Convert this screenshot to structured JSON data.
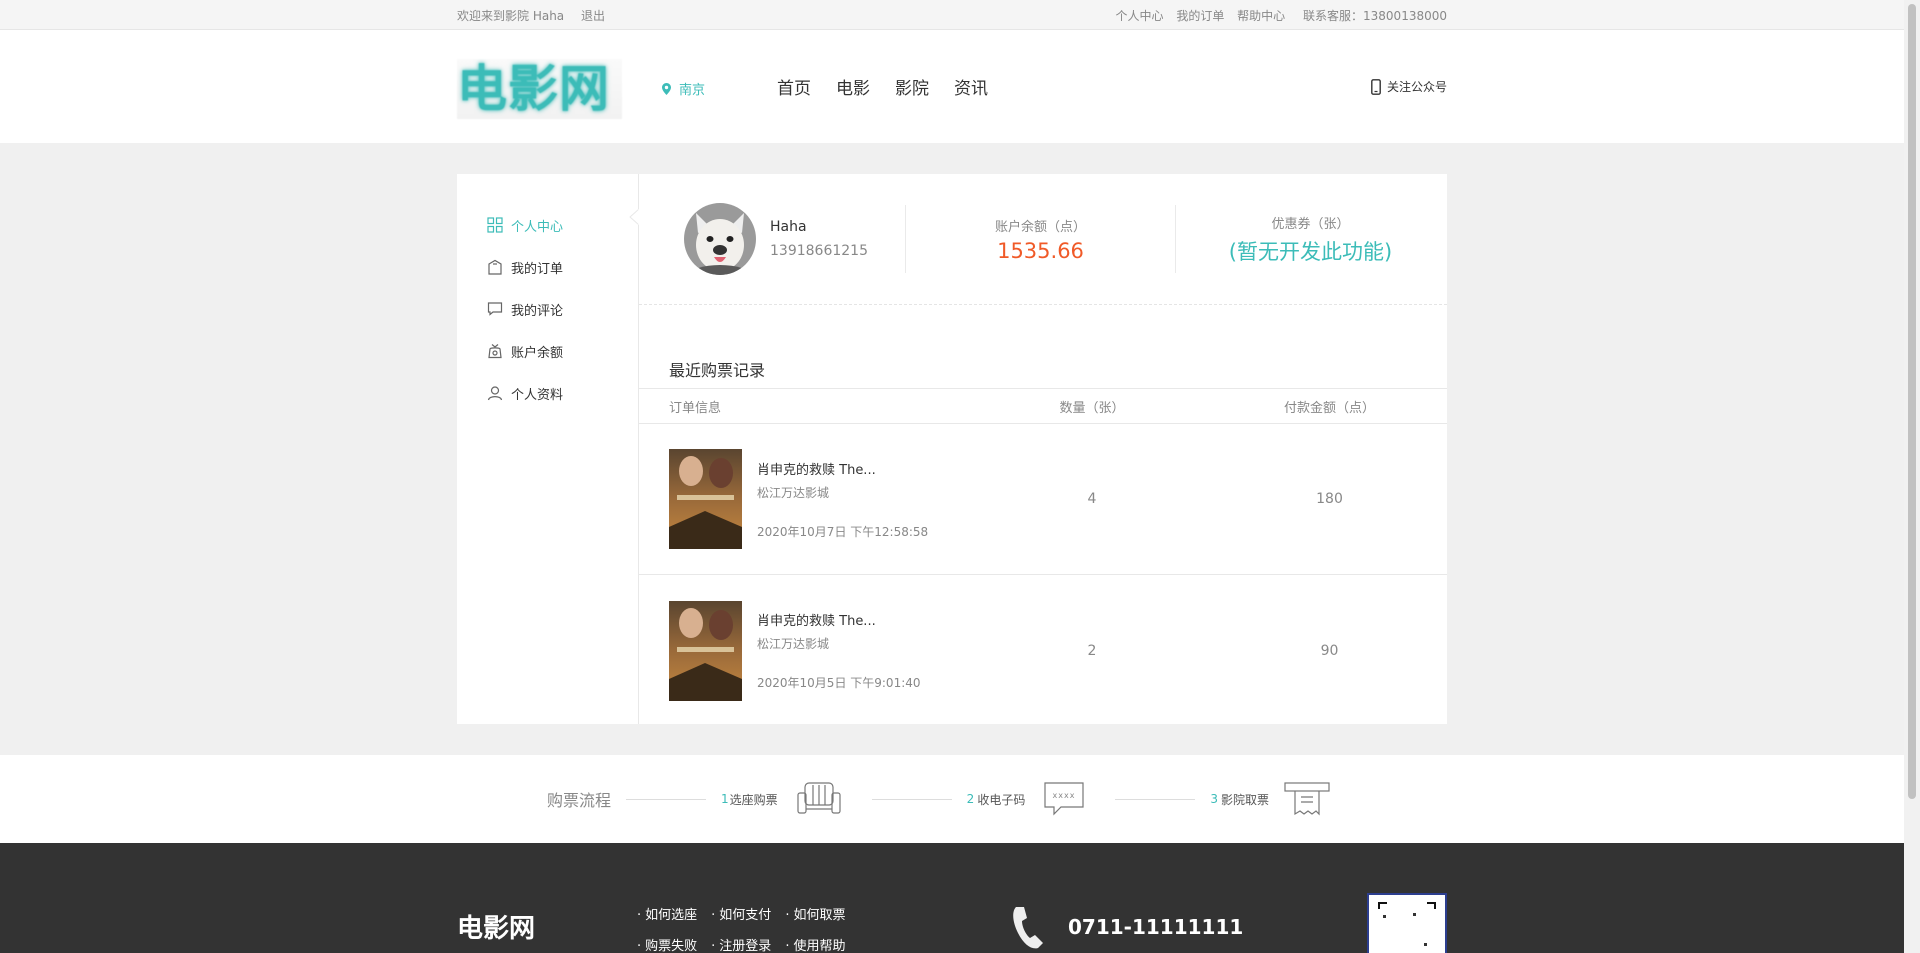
{
  "topbar": {
    "welcome": "欢迎来到影院 Haha",
    "logout": "退出",
    "links": [
      "个人中心",
      "我的订单",
      "帮助中心"
    ],
    "contact": "联系客服：13800138000"
  },
  "header": {
    "logo": "电影网",
    "city": "南京",
    "nav": [
      "首页",
      "电影",
      "影院",
      "资讯"
    ],
    "follow": "关注公众号"
  },
  "sidebar": {
    "items": [
      {
        "label": "个人中心",
        "icon": "grid-icon",
        "active": true
      },
      {
        "label": "我的订单",
        "icon": "bag-icon",
        "active": false
      },
      {
        "label": "我的评论",
        "icon": "comment-icon",
        "active": false
      },
      {
        "label": "账户余额",
        "icon": "wallet-icon",
        "active": false
      },
      {
        "label": "个人资料",
        "icon": "user-icon",
        "active": false
      }
    ]
  },
  "profile": {
    "name": "Haha",
    "phone": "13918661215",
    "balance_label": "账户余额（点）",
    "balance": "1535.66",
    "coupon_label": "优惠券（张）",
    "coupon": "(暂无开发此功能)"
  },
  "orders": {
    "title": "最近购票记录",
    "columns": [
      "订单信息",
      "数量（张）",
      "付款金额（点）"
    ],
    "rows": [
      {
        "movie": "肖申克的救赎 The...",
        "cinema": "松江万达影城",
        "time": "2020年10月7日 下午12:58:58",
        "qty": "4",
        "amount": "180"
      },
      {
        "movie": "肖申克的救赎 The...",
        "cinema": "松江万达影城",
        "time": "2020年10月5日 下午9:01:40",
        "qty": "2",
        "amount": "90"
      }
    ]
  },
  "flow": {
    "title": "购票流程",
    "steps": [
      {
        "num": "1",
        "label": "选座购票"
      },
      {
        "num": "2",
        "label": "收电子码"
      },
      {
        "num": "3",
        "label": "影院取票"
      }
    ],
    "code_text": "xxxx"
  },
  "footer": {
    "logo": "电影网",
    "links": [
      "如何选座",
      "如何支付",
      "如何取票",
      "购票失败",
      "注册登录",
      "使用帮助"
    ],
    "phone": "0711-11111111"
  },
  "colors": {
    "accent": "#3cbcb8",
    "balance": "#f05a28",
    "footer": "#333333"
  }
}
